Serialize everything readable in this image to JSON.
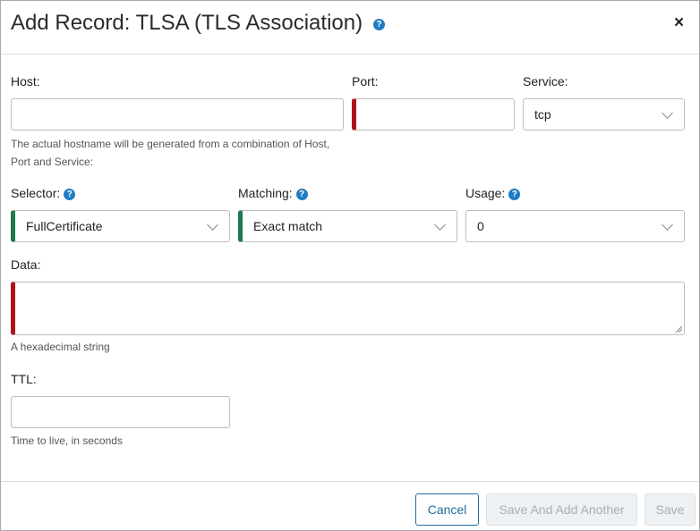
{
  "dialog": {
    "title": "Add Record: TLSA (TLS Association)",
    "help_glyph": "?",
    "close_glyph": "×"
  },
  "fields": {
    "host": {
      "label": "Host:",
      "value": "",
      "hint": "The actual hostname will be generated from a combination of Host, Port and Service:"
    },
    "port": {
      "label": "Port:",
      "value": ""
    },
    "service": {
      "label": "Service:",
      "value": "tcp"
    },
    "selector": {
      "label": "Selector:",
      "value": "FullCertificate"
    },
    "matching": {
      "label": "Matching:",
      "value": "Exact match"
    },
    "usage": {
      "label": "Usage:",
      "value": "0"
    },
    "data": {
      "label": "Data:",
      "value": "",
      "hint": "A hexadecimal string"
    },
    "ttl": {
      "label": "TTL:",
      "value": "",
      "hint": "Time to live, in seconds"
    }
  },
  "buttons": {
    "cancel": "Cancel",
    "save_and_add": "Save And Add Another",
    "save": "Save"
  },
  "colors": {
    "invalid": "#b0121c",
    "valid": "#1e7a4c",
    "help_icon": "#1f7cc3",
    "cancel_border": "#1f6f9a"
  }
}
